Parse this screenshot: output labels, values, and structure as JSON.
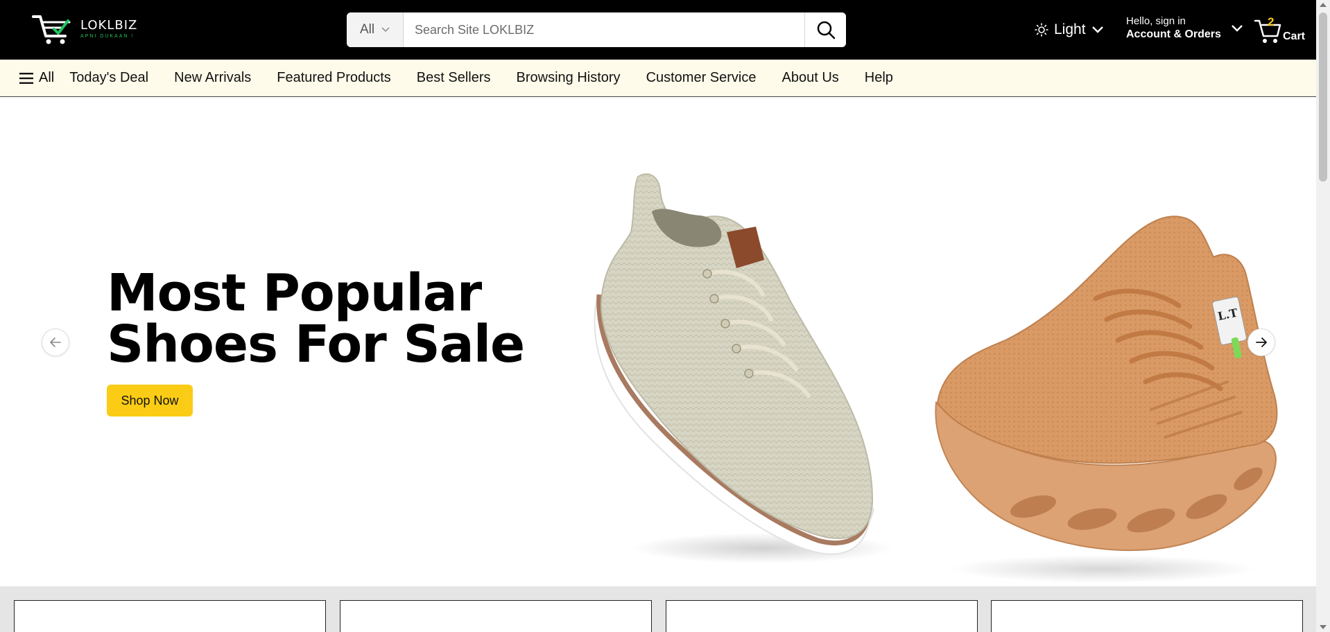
{
  "header": {
    "logo": {
      "name": "LOKLBIZ",
      "tagline": "APNI DUKAAN !"
    },
    "search": {
      "category": "All",
      "placeholder": "Search Site LOKLBIZ"
    },
    "theme": {
      "label": "Light"
    },
    "account": {
      "greeting": "Hello, sign in",
      "label": "Account & Orders"
    },
    "cart": {
      "count": "2",
      "label": "Cart"
    }
  },
  "nav": {
    "all_label": "All",
    "items": [
      {
        "label": "Today's Deal"
      },
      {
        "label": "New Arrivals"
      },
      {
        "label": "Featured Products"
      },
      {
        "label": "Best Sellers"
      },
      {
        "label": "Browsing History"
      },
      {
        "label": "Customer Service"
      },
      {
        "label": "About Us"
      },
      {
        "label": "Help"
      }
    ]
  },
  "hero": {
    "title_line1": "Most Popular",
    "title_line2": "Shoes For Sale",
    "cta": "Shop Now"
  },
  "colors": {
    "header_bg": "#000000",
    "nav_bg": "#fffbea",
    "accent_yellow": "#facc15",
    "logo_green": "#22c55e",
    "cards_area_bg": "#e5e5e5"
  },
  "icons": {
    "search": "search-icon",
    "theme": "sun-icon",
    "cart": "cart-icon",
    "menu": "hamburger-icon",
    "prev": "arrow-left-icon",
    "next": "arrow-right-icon"
  }
}
